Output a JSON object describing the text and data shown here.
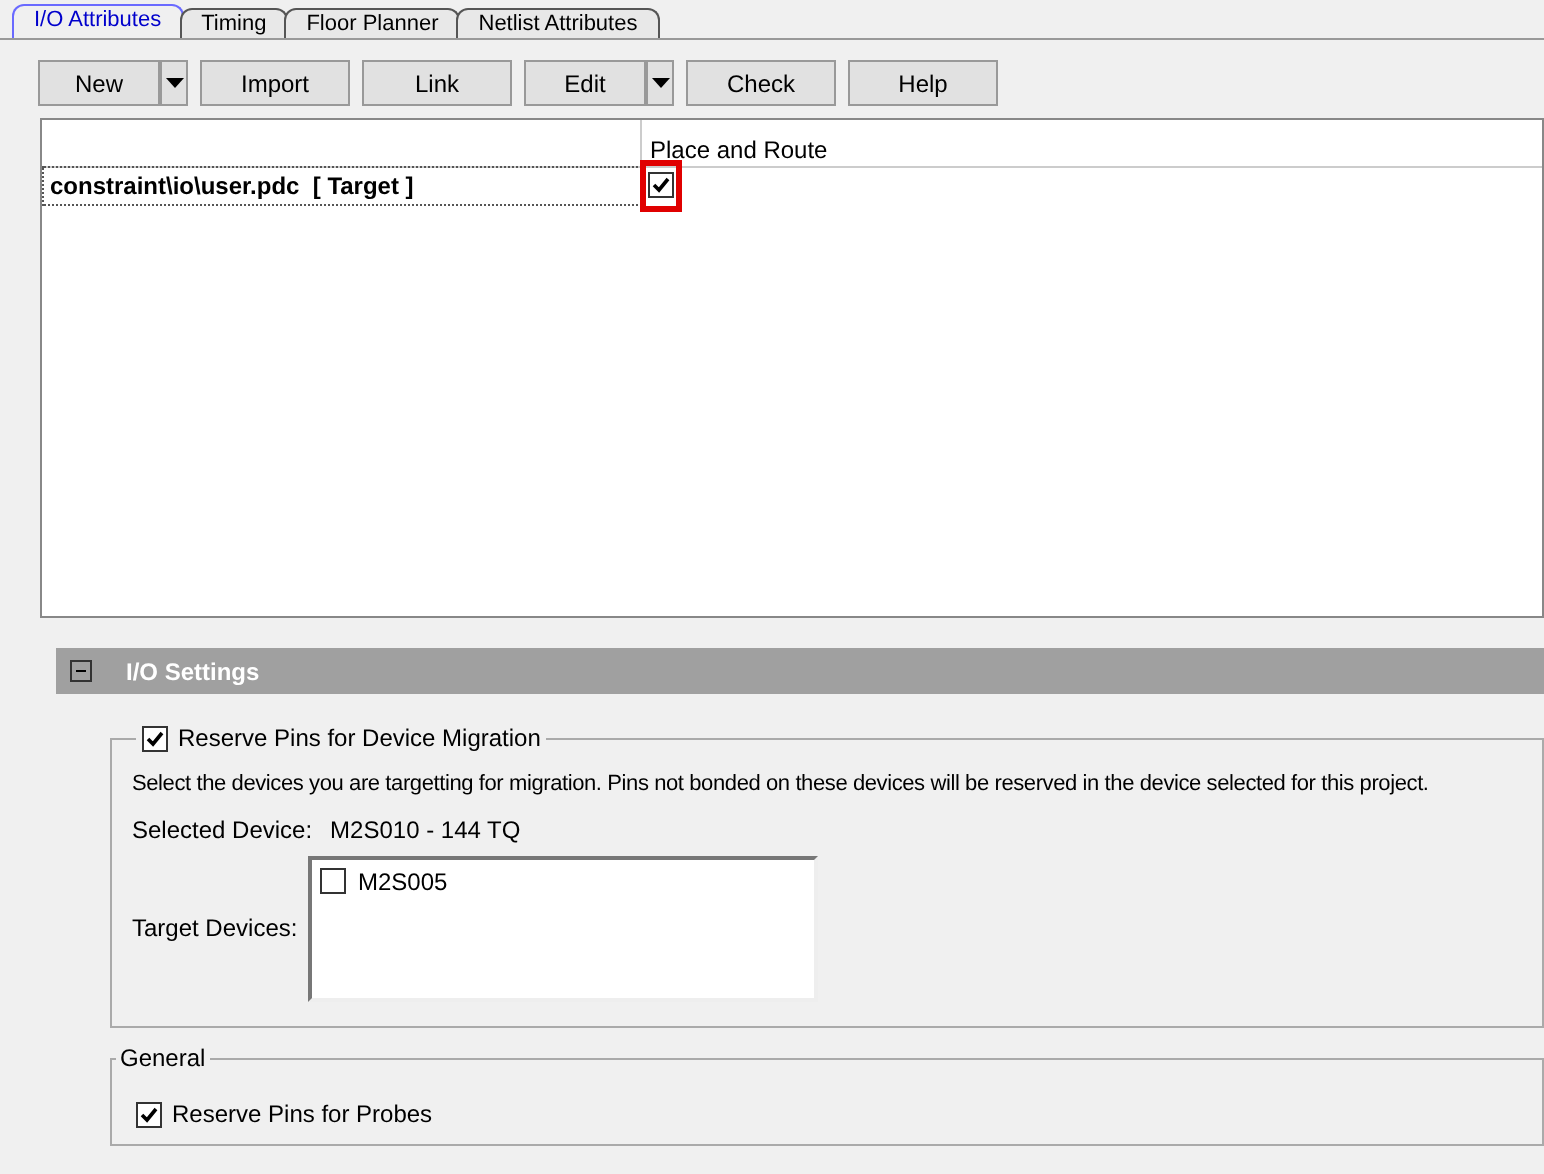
{
  "tabs": [
    {
      "label": "I/O Attributes",
      "selected": true
    },
    {
      "label": "Timing",
      "selected": false
    },
    {
      "label": "Floor Planner",
      "selected": false
    },
    {
      "label": "Netlist Attributes",
      "selected": false
    }
  ],
  "toolbar": [
    {
      "label": "New",
      "kind": "split"
    },
    {
      "label": "Import",
      "kind": "plain"
    },
    {
      "label": "Link",
      "kind": "plain"
    },
    {
      "label": "Edit",
      "kind": "split"
    },
    {
      "label": "Check",
      "kind": "plain"
    },
    {
      "label": "Help",
      "kind": "plain"
    }
  ],
  "table": {
    "columns": [
      "Place and Route"
    ],
    "rows": [
      {
        "file": "constraint\\io\\user.pdc  [ Target ]",
        "checked": true,
        "highlighted": true
      }
    ]
  },
  "io_settings": {
    "title": "I/O Settings",
    "expanded": true,
    "migration": {
      "label": "Reserve Pins for Device Migration",
      "checked": true,
      "description": "Select the devices you are targetting for migration. Pins not bonded on these devices will be reserved in the device selected for this project.",
      "selected_device_label": "Selected Device:",
      "selected_device": "M2S010 - 144 TQ",
      "target_label": "Target Devices:",
      "targets": [
        {
          "label": "M2S005",
          "checked": false
        }
      ]
    },
    "general": {
      "title": "General",
      "probes": {
        "label": "Reserve Pins for Probes",
        "checked": true
      }
    }
  }
}
